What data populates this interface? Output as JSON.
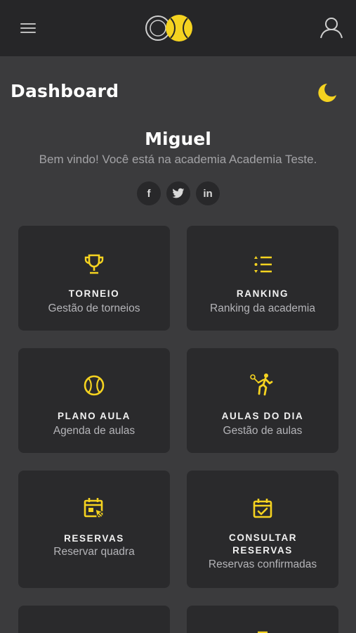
{
  "colors": {
    "background": "#3b3b3d",
    "topbar": "#262628",
    "card": "#2a2a2c",
    "accent": "#f5d320"
  },
  "header": {
    "menu_icon": "hamburger-icon",
    "logo": "tennis-ball-logo",
    "user_icon": "user-icon"
  },
  "page": {
    "title": "Dashboard",
    "theme_icon": "moon-icon"
  },
  "profile": {
    "name": "Miguel",
    "welcome": "Bem vindo! Você está na academia Academia Teste."
  },
  "social": [
    {
      "icon": "facebook-icon",
      "label": "f"
    },
    {
      "icon": "twitter-icon",
      "label": "t"
    },
    {
      "icon": "linkedin-icon",
      "label": "in"
    }
  ],
  "cards": [
    {
      "icon": "trophy-icon",
      "title": "TORNEIO",
      "subtitle": "Gestão de torneios"
    },
    {
      "icon": "ranking-list-icon",
      "title": "RANKING",
      "subtitle": "Ranking da academia"
    },
    {
      "icon": "tennis-ball-icon",
      "title": "PLANO AULA",
      "subtitle": "Agenda de aulas"
    },
    {
      "icon": "tennis-player-icon",
      "title": "AULAS DO DIA",
      "subtitle": "Gestão de aulas"
    },
    {
      "icon": "calendar-cursor-icon",
      "title": "RESERVAS",
      "subtitle": "Reservar quadra"
    },
    {
      "icon": "calendar-check-icon",
      "title": "CONSULTAR RESERVAS",
      "subtitle": "Reservas confirmadas"
    }
  ]
}
